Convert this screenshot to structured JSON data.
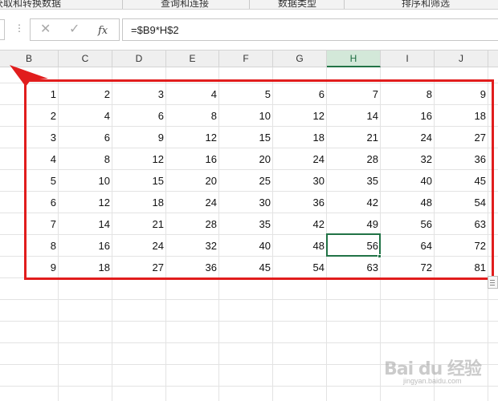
{
  "ribbon": {
    "groups": [
      "获取和转换数据",
      "查询和连接",
      "数据类型",
      "排序和筛选"
    ]
  },
  "formula_bar": {
    "cancel_glyph": "✕",
    "enter_glyph": "✓",
    "fx_label": "fx",
    "formula": "=$B9*H$2"
  },
  "columns": [
    "B",
    "C",
    "D",
    "E",
    "F",
    "G",
    "H",
    "I",
    "J"
  ],
  "active_column": "H",
  "table": [
    [
      "1",
      "2",
      "3",
      "4",
      "5",
      "6",
      "7",
      "8",
      "9"
    ],
    [
      "2",
      "4",
      "6",
      "8",
      "10",
      "12",
      "14",
      "16",
      "18"
    ],
    [
      "3",
      "6",
      "9",
      "12",
      "15",
      "18",
      "21",
      "24",
      "27"
    ],
    [
      "4",
      "8",
      "12",
      "16",
      "20",
      "24",
      "28",
      "32",
      "36"
    ],
    [
      "5",
      "10",
      "15",
      "20",
      "25",
      "30",
      "35",
      "40",
      "45"
    ],
    [
      "6",
      "12",
      "18",
      "24",
      "30",
      "36",
      "42",
      "48",
      "54"
    ],
    [
      "7",
      "14",
      "21",
      "28",
      "35",
      "42",
      "49",
      "56",
      "63"
    ],
    [
      "8",
      "16",
      "24",
      "32",
      "40",
      "48",
      "56",
      "64",
      "72"
    ],
    [
      "9",
      "18",
      "27",
      "36",
      "45",
      "54",
      "63",
      "72",
      "81"
    ]
  ],
  "selected_cell": {
    "column": "H",
    "row_index": 7
  },
  "annotation_color": "#e11d1d",
  "accent_color": "#217346",
  "watermark": {
    "main": "Bai du 经验",
    "sub": "jingyan.baidu.com"
  }
}
